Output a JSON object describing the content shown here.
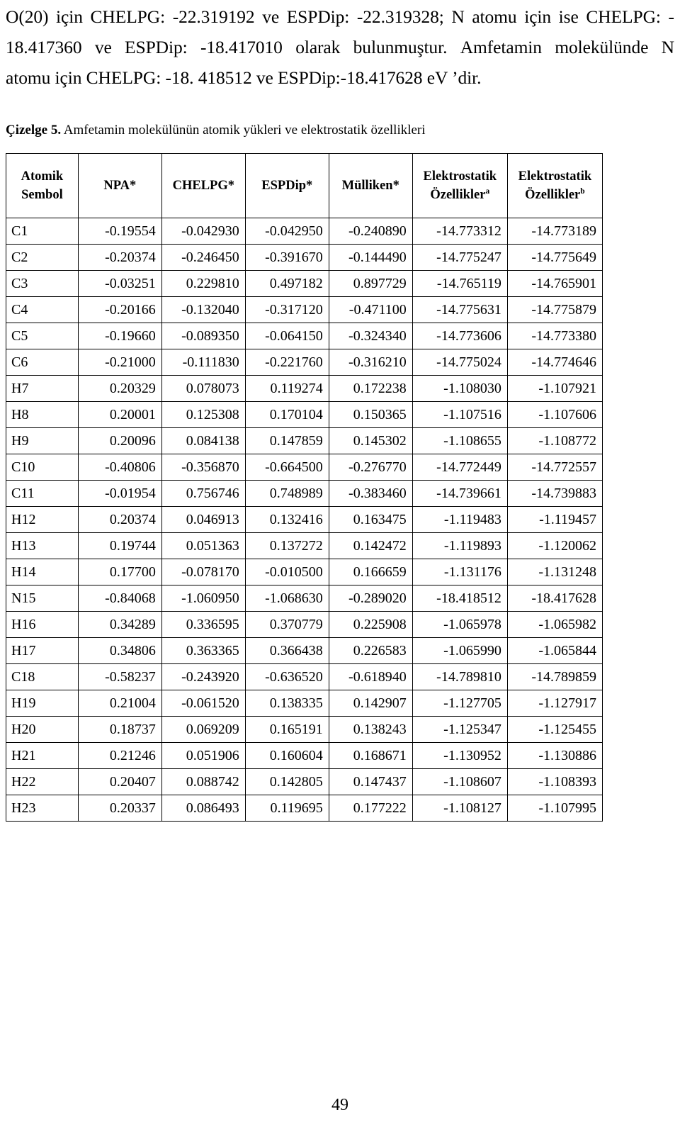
{
  "document": {
    "page_number": "49"
  },
  "intro": {
    "lines": [
      "O(20) için CHELPG: -22.319192 ve ESPDip: -22.319328; N atomu için ise CHELPG: -",
      "18.417360 ve ESPDip: -18.417010 olarak bulunmuştur.   Amfetamin molekülünde N",
      "atomu için CHELPG: -18. 418512 ve ESPDip:-18.417628 eV ’dir."
    ],
    "line1_segments": [
      "O(20)",
      "için",
      "CHELPG:",
      "-22.319192",
      "ve",
      "ESPDip:",
      "-22.319328;",
      "N",
      "atomu",
      "için",
      "ise",
      "CHELPG:",
      "-"
    ],
    "line2_segments": [
      "18.417360",
      "ve",
      "ESPDip:",
      "-18.417010",
      "olarak",
      "bulunmuştur.",
      "Amfetamin",
      "molekülünde",
      "N"
    ],
    "line3": "atomu için CHELPG: -18. 418512 ve ESPDip:-18.417628 eV ’dir."
  },
  "caption": {
    "label": "Çizelge 5.",
    "text": " Amfetamin molekülünün atomik yükleri ve elektrostatik özellikleri"
  },
  "table": {
    "headers": [
      {
        "line1": "Atomik",
        "line2": "Sembol",
        "sup": ""
      },
      {
        "line1": "NPA*",
        "line2": "",
        "sup": ""
      },
      {
        "line1": "CHELPG*",
        "line2": "",
        "sup": ""
      },
      {
        "line1": "ESPDip*",
        "line2": "",
        "sup": ""
      },
      {
        "line1": "Mülliken*",
        "line2": "",
        "sup": ""
      },
      {
        "line1": "Elektrostatik",
        "line2": "Özellikler",
        "sup": "a"
      },
      {
        "line1": "Elektrostatik",
        "line2": "Özellikler",
        "sup": "b"
      }
    ],
    "rows": [
      {
        "symbol": "C1",
        "npa": "-0.19554",
        "chelpg": "-0.042930",
        "espdip": "-0.042950",
        "mulliken": "-0.240890",
        "electrostatic_a": "-14.773312",
        "electrostatic_b": "-14.773189"
      },
      {
        "symbol": "C2",
        "npa": "-0.20374",
        "chelpg": "-0.246450",
        "espdip": "-0.391670",
        "mulliken": "-0.144490",
        "electrostatic_a": "-14.775247",
        "electrostatic_b": "-14.775649"
      },
      {
        "symbol": "C3",
        "npa": "-0.03251",
        "chelpg": "0.229810",
        "espdip": "0.497182",
        "mulliken": "0.897729",
        "electrostatic_a": "-14.765119",
        "electrostatic_b": "-14.765901"
      },
      {
        "symbol": "C4",
        "npa": "-0.20166",
        "chelpg": "-0.132040",
        "espdip": "-0.317120",
        "mulliken": "-0.471100",
        "electrostatic_a": "-14.775631",
        "electrostatic_b": "-14.775879"
      },
      {
        "symbol": "C5",
        "npa": "-0.19660",
        "chelpg": "-0.089350",
        "espdip": "-0.064150",
        "mulliken": "-0.324340",
        "electrostatic_a": "-14.773606",
        "electrostatic_b": "-14.773380"
      },
      {
        "symbol": "C6",
        "npa": "-0.21000",
        "chelpg": "-0.111830",
        "espdip": "-0.221760",
        "mulliken": "-0.316210",
        "electrostatic_a": "-14.775024",
        "electrostatic_b": "-14.774646"
      },
      {
        "symbol": "H7",
        "npa": "0.20329",
        "chelpg": "0.078073",
        "espdip": "0.119274",
        "mulliken": "0.172238",
        "electrostatic_a": "-1.108030",
        "electrostatic_b": "-1.107921"
      },
      {
        "symbol": "H8",
        "npa": "0.20001",
        "chelpg": "0.125308",
        "espdip": "0.170104",
        "mulliken": "0.150365",
        "electrostatic_a": "-1.107516",
        "electrostatic_b": "-1.107606"
      },
      {
        "symbol": "H9",
        "npa": "0.20096",
        "chelpg": "0.084138",
        "espdip": "0.147859",
        "mulliken": "0.145302",
        "electrostatic_a": "-1.108655",
        "electrostatic_b": "-1.108772"
      },
      {
        "symbol": "C10",
        "npa": "-0.40806",
        "chelpg": "-0.356870",
        "espdip": "-0.664500",
        "mulliken": "-0.276770",
        "electrostatic_a": "-14.772449",
        "electrostatic_b": "-14.772557"
      },
      {
        "symbol": "C11",
        "npa": "-0.01954",
        "chelpg": "0.756746",
        "espdip": "0.748989",
        "mulliken": "-0.383460",
        "electrostatic_a": "-14.739661",
        "electrostatic_b": "-14.739883"
      },
      {
        "symbol": "H12",
        "npa": "0.20374",
        "chelpg": "0.046913",
        "espdip": "0.132416",
        "mulliken": "0.163475",
        "electrostatic_a": "-1.119483",
        "electrostatic_b": "-1.119457"
      },
      {
        "symbol": "H13",
        "npa": "0.19744",
        "chelpg": "0.051363",
        "espdip": "0.137272",
        "mulliken": "0.142472",
        "electrostatic_a": "-1.119893",
        "electrostatic_b": "-1.120062"
      },
      {
        "symbol": "H14",
        "npa": "0.17700",
        "chelpg": "-0.078170",
        "espdip": "-0.010500",
        "mulliken": "0.166659",
        "electrostatic_a": "-1.131176",
        "electrostatic_b": "-1.131248"
      },
      {
        "symbol": "N15",
        "npa": "-0.84068",
        "chelpg": "-1.060950",
        "espdip": "-1.068630",
        "mulliken": "-0.289020",
        "electrostatic_a": "-18.418512",
        "electrostatic_b": "-18.417628"
      },
      {
        "symbol": "H16",
        "npa": "0.34289",
        "chelpg": "0.336595",
        "espdip": "0.370779",
        "mulliken": "0.225908",
        "electrostatic_a": "-1.065978",
        "electrostatic_b": "-1.065982"
      },
      {
        "symbol": "H17",
        "npa": "0.34806",
        "chelpg": "0.363365",
        "espdip": "0.366438",
        "mulliken": "0.226583",
        "electrostatic_a": "-1.065990",
        "electrostatic_b": "-1.065844"
      },
      {
        "symbol": "C18",
        "npa": "-0.58237",
        "chelpg": "-0.243920",
        "espdip": "-0.636520",
        "mulliken": "-0.618940",
        "electrostatic_a": "-14.789810",
        "electrostatic_b": "-14.789859"
      },
      {
        "symbol": "H19",
        "npa": "0.21004",
        "chelpg": "-0.061520",
        "espdip": "0.138335",
        "mulliken": "0.142907",
        "electrostatic_a": "-1.127705",
        "electrostatic_b": "-1.127917"
      },
      {
        "symbol": "H20",
        "npa": "0.18737",
        "chelpg": "0.069209",
        "espdip": "0.165191",
        "mulliken": "0.138243",
        "electrostatic_a": "-1.125347",
        "electrostatic_b": "-1.125455"
      },
      {
        "symbol": "H21",
        "npa": "0.21246",
        "chelpg": "0.051906",
        "espdip": "0.160604",
        "mulliken": "0.168671",
        "electrostatic_a": "-1.130952",
        "electrostatic_b": "-1.130886"
      },
      {
        "symbol": "H22",
        "npa": "0.20407",
        "chelpg": "0.088742",
        "espdip": "0.142805",
        "mulliken": "0.147437",
        "electrostatic_a": "-1.108607",
        "electrostatic_b": "-1.108393"
      },
      {
        "symbol": "H23",
        "npa": "0.20337",
        "chelpg": "0.086493",
        "espdip": "0.119695",
        "mulliken": "0.177222",
        "electrostatic_a": "-1.108127",
        "electrostatic_b": "-1.107995"
      }
    ]
  }
}
